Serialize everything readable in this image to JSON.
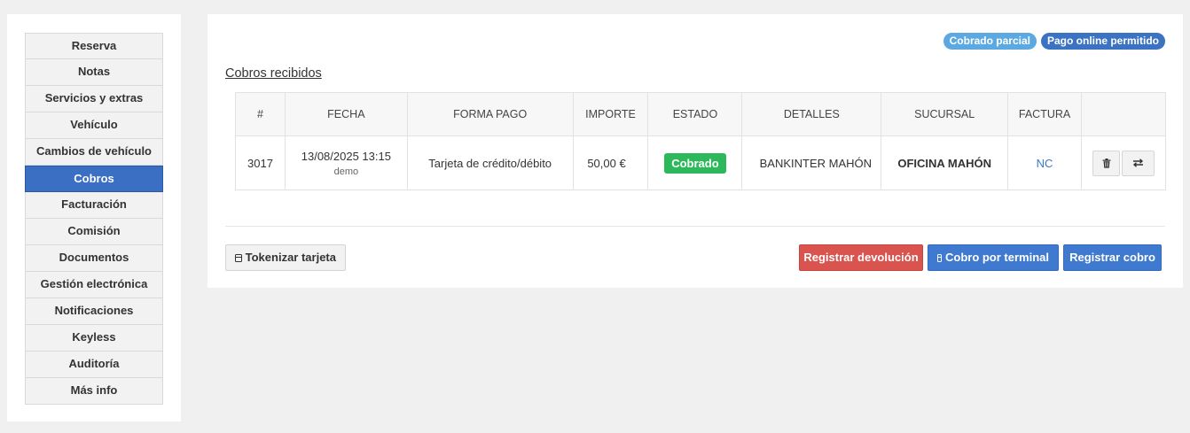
{
  "sidebar": {
    "items": [
      {
        "label": "Reserva"
      },
      {
        "label": "Notas"
      },
      {
        "label": "Servicios y extras"
      },
      {
        "label": "Vehículo"
      },
      {
        "label": "Cambios de vehículo"
      },
      {
        "label": "Cobros",
        "active": true
      },
      {
        "label": "Facturación"
      },
      {
        "label": "Comisión"
      },
      {
        "label": "Documentos"
      },
      {
        "label": "Gestión electrónica"
      },
      {
        "label": "Notificaciones"
      },
      {
        "label": "Keyless"
      },
      {
        "label": "Auditoría"
      },
      {
        "label": "Más info"
      }
    ]
  },
  "badges": {
    "partial": "Cobrado parcial",
    "online": "Pago online permitido"
  },
  "section": {
    "title": "Cobros recibidos"
  },
  "table": {
    "headers": [
      "#",
      "FECHA",
      "FORMA PAGO",
      "IMPORTE",
      "ESTADO",
      "DETALLES",
      "SUCURSAL",
      "FACTURA"
    ],
    "rows": [
      {
        "id": "3017",
        "fecha": "13/08/2025 13:15",
        "usuario": "demo",
        "forma_pago": "Tarjeta de crédito/débito",
        "importe": "50,00 €",
        "estado": "Cobrado",
        "detalles": "BANKINTER MAHÓN",
        "sucursal": "OFICINA MAHÓN",
        "factura": "NC"
      }
    ]
  },
  "actions": {
    "tokenizar": "Tokenizar tarjeta",
    "devolucion": "Registrar devolución",
    "terminal": "Cobro por terminal",
    "registrar": "Registrar cobro"
  },
  "icons": {
    "trash": "trash-icon",
    "swap": "swap-icon",
    "card": "credit-card-icon"
  },
  "colors": {
    "active_nav": "#3a6fc4",
    "badge_light": "#5ba9e0",
    "badge_dark": "#3b73c2",
    "status_green": "#2eb85c",
    "danger": "#d9534f",
    "primary": "#3f7ad0"
  }
}
